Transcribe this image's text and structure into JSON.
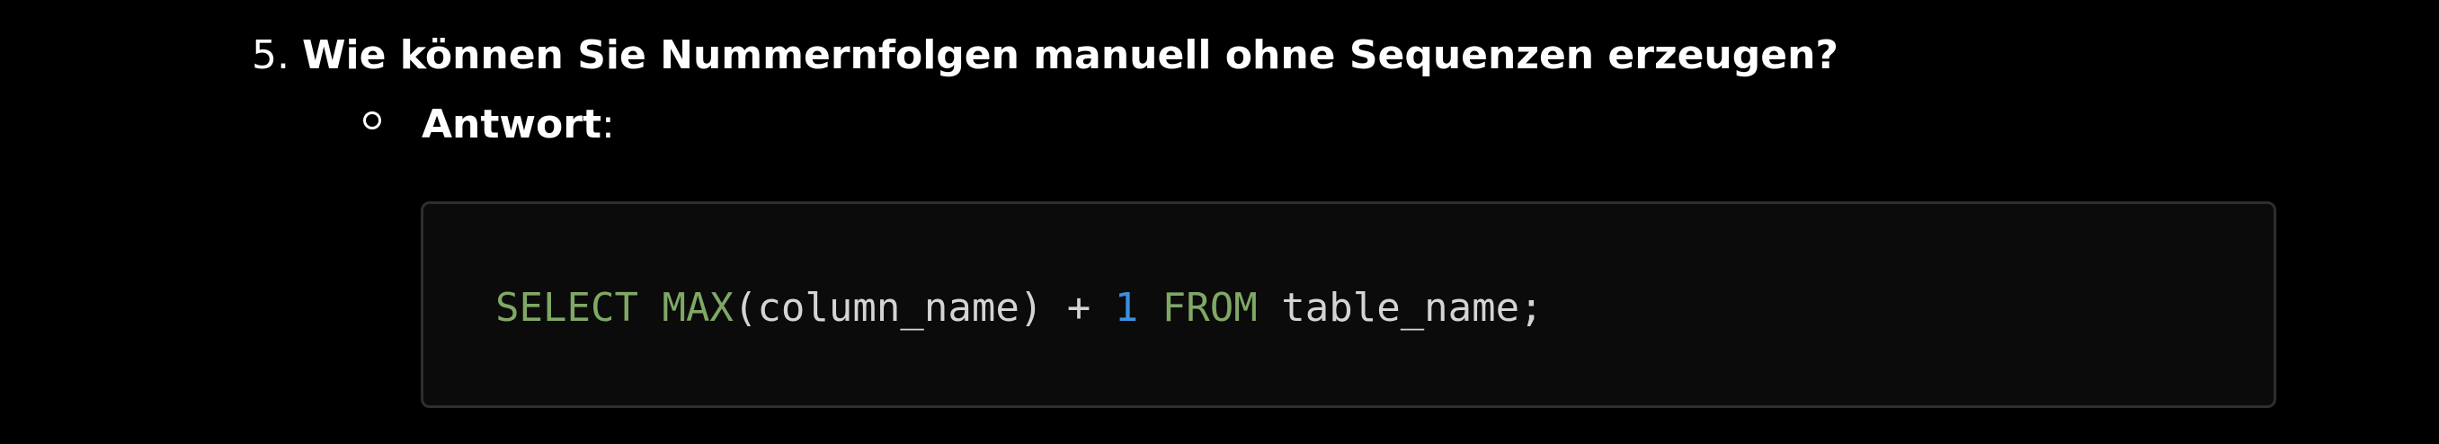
{
  "question": {
    "number": "5.",
    "text": "Wie können Sie Nummernfolgen manuell ohne Sequenzen erzeugen?"
  },
  "answer": {
    "label": "Antwort",
    "colon": ":"
  },
  "code": {
    "tokens": {
      "t1": "SELECT",
      "t2": " ",
      "t3": "MAX",
      "t4": "(column_name) + ",
      "t5": "1",
      "t6": " ",
      "t7": "FROM",
      "t8": " table_name;"
    },
    "colors": {
      "keyword": "#7fa865",
      "number": "#3b8fe0",
      "plain": "#d4d4d4",
      "background": "#0b0b0b",
      "border": "#2e2e2e"
    }
  }
}
